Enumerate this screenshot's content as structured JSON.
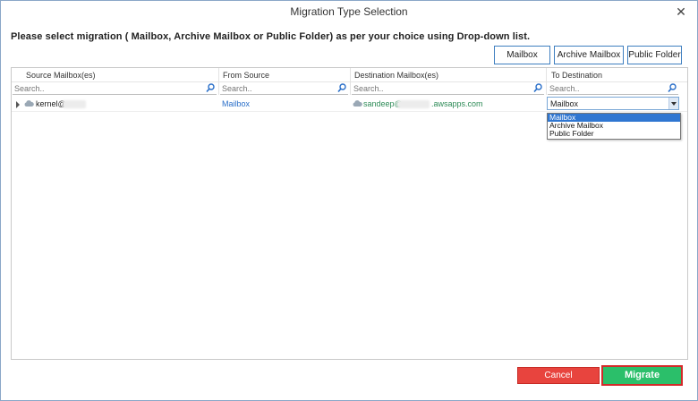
{
  "window": {
    "title": "Migration Type Selection",
    "close_glyph": "✕"
  },
  "instruction": "Please select migration ( Mailbox, Archive Mailbox or Public Folder) as per your choice using Drop-down list.",
  "type_buttons": {
    "mailbox": "Mailbox",
    "archive": "Archive Mailbox",
    "public": "Public Folder"
  },
  "columns": [
    {
      "header": "Source Mailbox(es)",
      "placeholder": "Search.."
    },
    {
      "header": "From Source",
      "placeholder": "Search.."
    },
    {
      "header": "Destination Mailbox(es)",
      "placeholder": "Search.."
    },
    {
      "header": "To Destination",
      "placeholder": "Search.."
    }
  ],
  "rows": [
    {
      "source": "kernel@",
      "from_source": "Mailbox",
      "destination_prefix": "sandeep@",
      "destination_suffix": ".awsapps.com",
      "to_destination": "Mailbox"
    }
  ],
  "dropdown_options": [
    "Mailbox",
    "Archive Mailbox",
    "Public Folder"
  ],
  "footer": {
    "cancel": "Cancel",
    "migrate": "Migrate"
  },
  "colors": {
    "accent_blue": "#3f7fc0",
    "link_blue": "#2a6fc9",
    "dest_green": "#2e8b57",
    "cancel_red": "#e8443e",
    "migrate_green": "#2bbf6a",
    "highlight_border": "#d32a2a"
  },
  "icons": {
    "filter": "search-icon",
    "account": "cloud-icon",
    "expand": "expand-arrow-icon"
  }
}
